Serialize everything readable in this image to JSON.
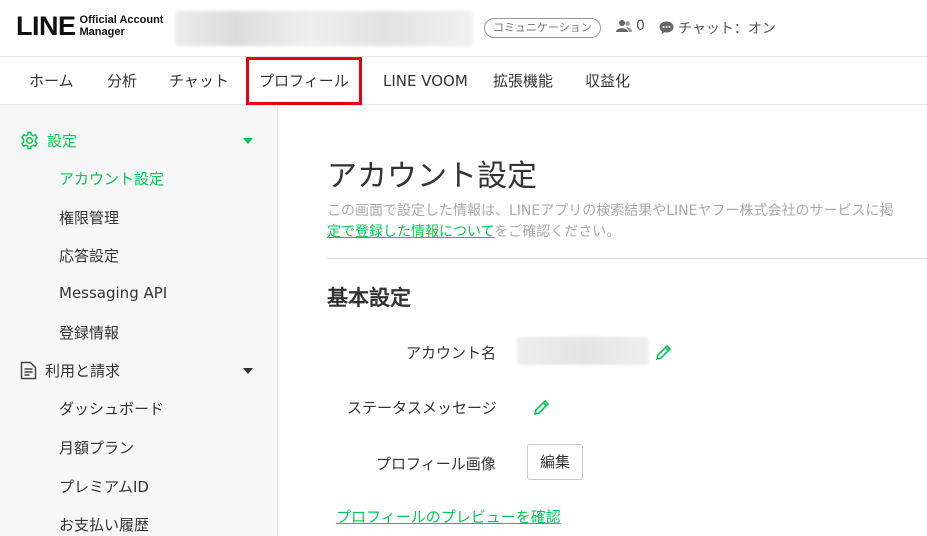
{
  "header": {
    "logo_main": "LINE",
    "logo_sub_1": "Official Account",
    "logo_sub_2": "Manager",
    "plan_badge": "コミュニケーション",
    "follower_count": "0",
    "chat_status": "チャット：オン"
  },
  "nav": {
    "tabs": [
      {
        "label": "ホーム"
      },
      {
        "label": "分析"
      },
      {
        "label": "チャット"
      },
      {
        "label": "プロフィール"
      },
      {
        "label": "LINE VOOM"
      },
      {
        "label": "拡張機能"
      },
      {
        "label": "収益化"
      }
    ],
    "highlighted_tab": "プロフィール"
  },
  "sidebar": {
    "sections": [
      {
        "label": "設定",
        "icon": "gear-icon",
        "items": [
          "アカウント設定",
          "権限管理",
          "応答設定",
          "Messaging API",
          "登録情報"
        ]
      },
      {
        "label": "利用と請求",
        "icon": "document-icon",
        "items": [
          "ダッシュボード",
          "月額プラン",
          "プレミアムID",
          "お支払い履歴"
        ]
      }
    ],
    "active_item": "アカウント設定"
  },
  "main": {
    "title": "アカウント設定",
    "description_line1": "この画面で設定した情報は、LINEアプリの検索結果やLINEヤフー株式会社のサービスに掲",
    "description_link": "定で登録した情報について",
    "description_tail": "をご確認ください。",
    "basic_settings_title": "基本設定",
    "fields": {
      "account_name_label": "アカウント名",
      "status_message_label": "ステータスメッセージ",
      "profile_image_label": "プロフィール画像",
      "edit_button": "編集"
    },
    "preview_link": "プロフィールのプレビューを確認"
  },
  "colors": {
    "accent_green": "#06c755",
    "highlight_red": "#e60012"
  }
}
